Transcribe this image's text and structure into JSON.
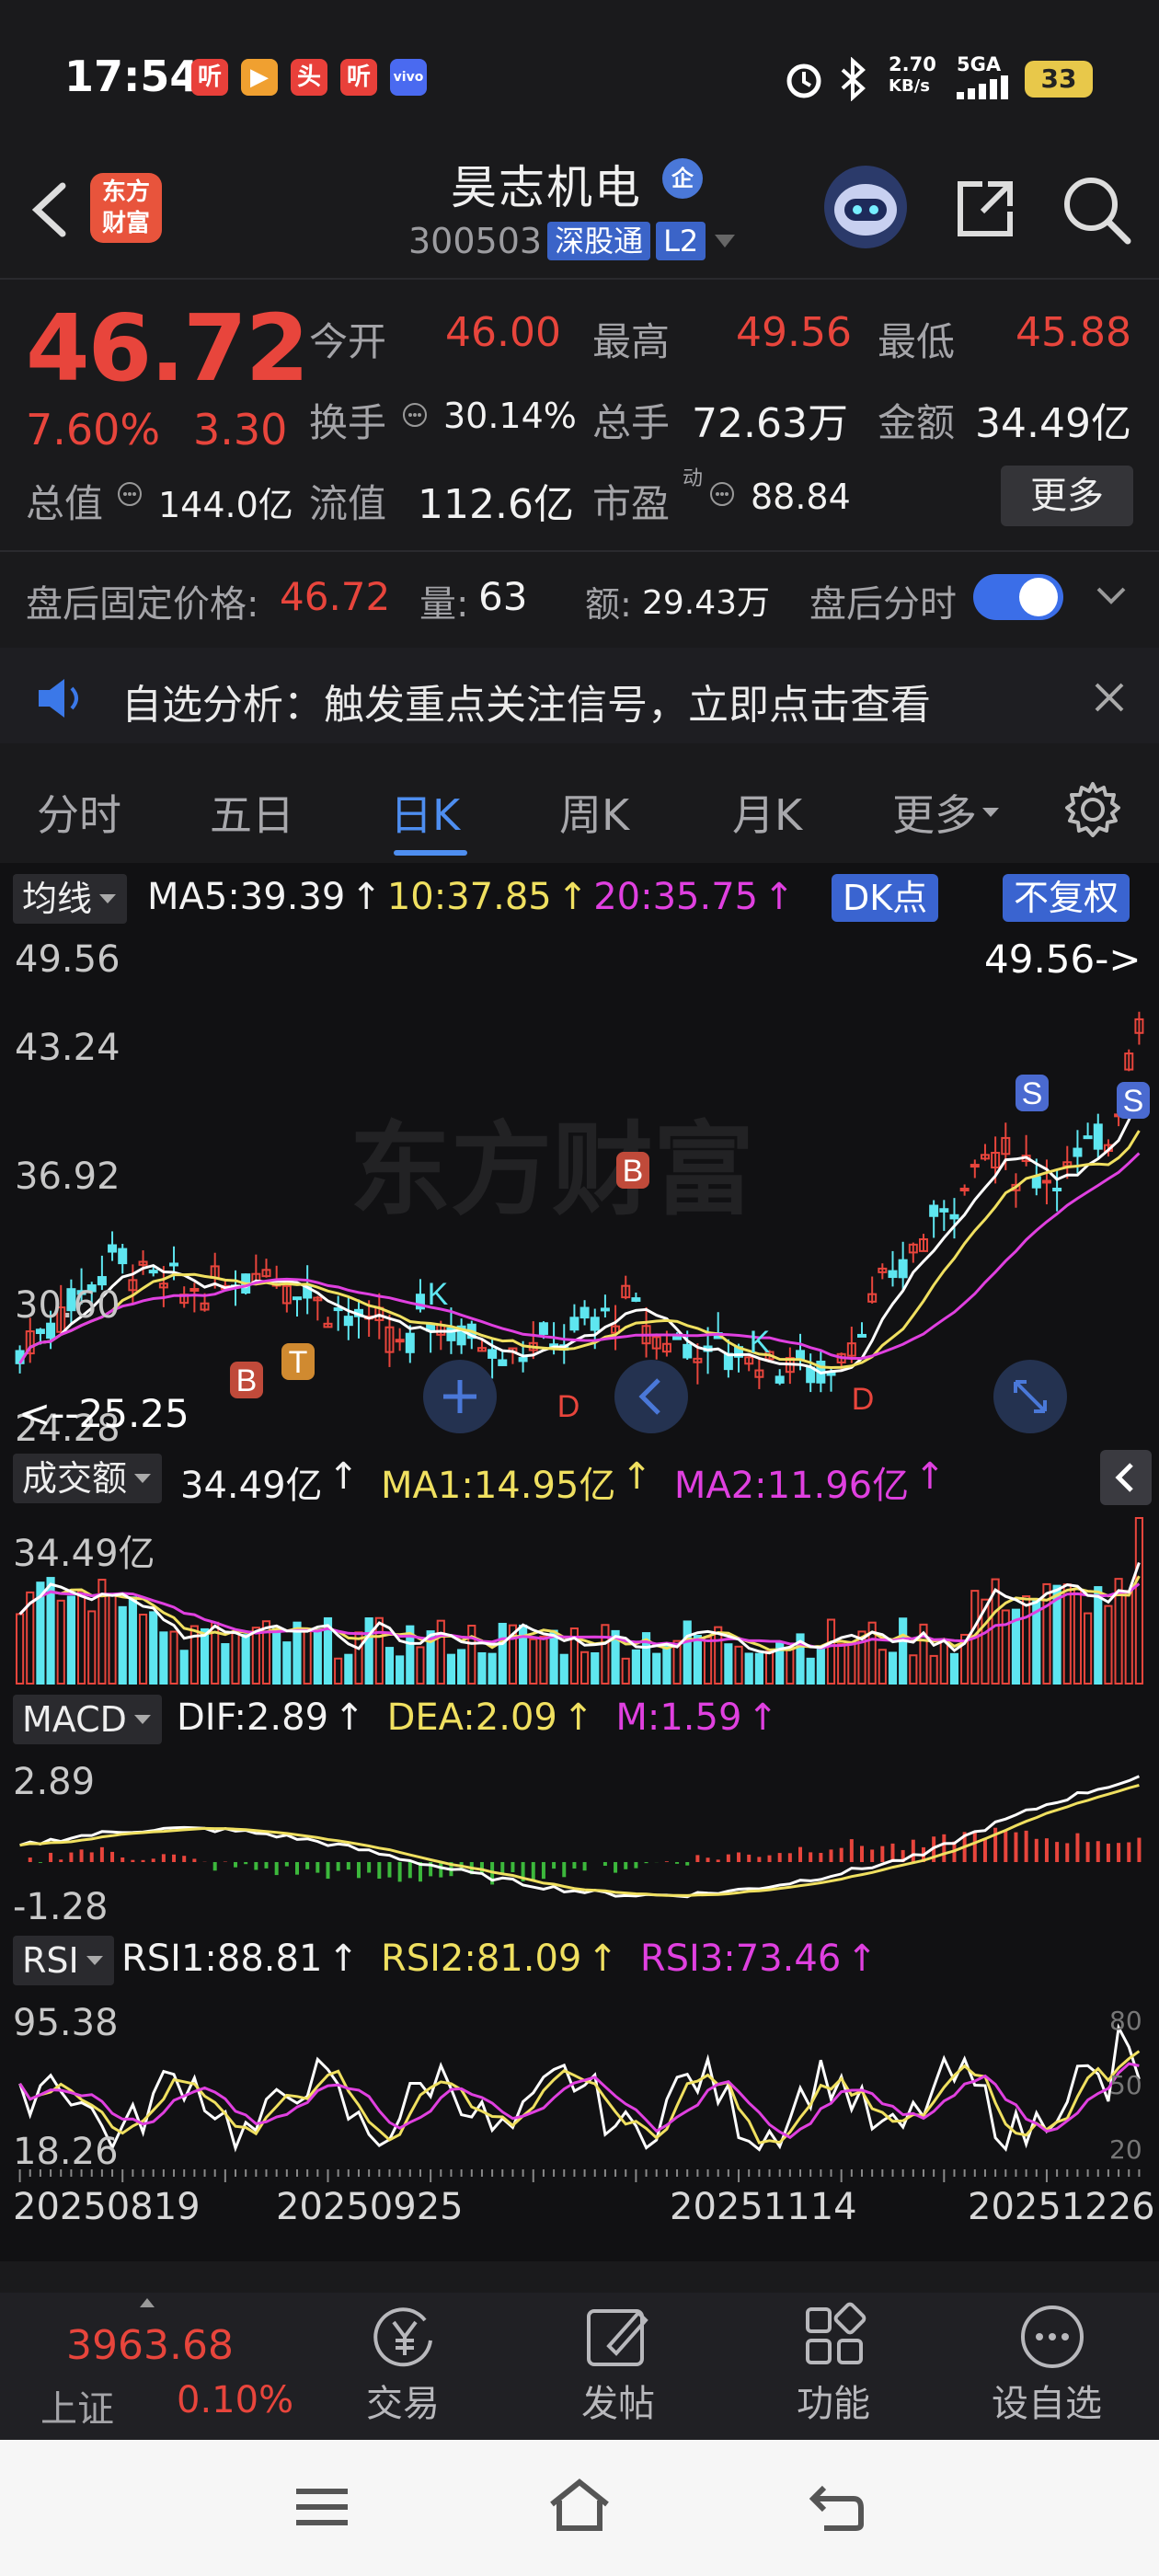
{
  "status_bar": {
    "time": "17:54",
    "net_speed_value": "2.70",
    "net_speed_unit": "KB/s",
    "network": "5GA",
    "battery": "33",
    "apps": [
      "听",
      "▶",
      "头",
      "听",
      "vivo"
    ]
  },
  "header": {
    "logo_line1": "东方",
    "logo_line2": "财富",
    "stock_name": "昊志机电",
    "qi_badge": "企",
    "stock_code": "300503",
    "tag_connect": "深股通",
    "tag_level": "L2"
  },
  "quote": {
    "price": "46.72",
    "pct_change": "7.60%",
    "change": "3.30",
    "open_label": "今开",
    "open_value": "46.00",
    "high_label": "最高",
    "high_value": "49.56",
    "low_label": "最低",
    "low_value": "45.88",
    "turnover_label": "换手",
    "turnover_value": "30.14%",
    "volume_label": "总手",
    "volume_value": "72.63万",
    "amount_label": "金额",
    "amount_value": "34.49亿",
    "mktcap_label": "总值",
    "mktcap_value": "144.0亿",
    "float_label": "流值",
    "float_value": "112.6亿",
    "pe_label": "市盈",
    "pe_sup": "动",
    "pe_value": "88.84",
    "more_button": "更多"
  },
  "after_hours": {
    "price_label": "盘后固定价格:",
    "price_value": "46.72",
    "vol_label": "量:",
    "vol_value": "63",
    "amt_label": "额:",
    "amt_value": "29.43万",
    "toggle_label": "盘后分时",
    "toggle_on": true
  },
  "notice": {
    "text": "自选分析：触发重点关注信号，立即点击查看"
  },
  "tabs": [
    {
      "label": "分时",
      "active": false
    },
    {
      "label": "五日",
      "active": false
    },
    {
      "label": "日K",
      "active": true
    },
    {
      "label": "周K",
      "active": false
    },
    {
      "label": "月K",
      "active": false
    },
    {
      "label": "更多",
      "active": false
    }
  ],
  "ma_legend": {
    "selector": "均线",
    "ma5": "MA5:39.39",
    "ma10": "10:37.85",
    "ma20": "20:35.75",
    "arrow": "↑",
    "dk_button": "DK点",
    "fq_button": "不复权"
  },
  "kline_axis": {
    "high": "49.56",
    "tick2": "43.24",
    "tick3": "36.92",
    "tick4": "30.60",
    "low": "24.28",
    "high_marker": "49.56->",
    "low_marker": "<--25.25",
    "watermark": "东方财富",
    "markers": [
      "B",
      "T",
      "B",
      "K",
      "K",
      "S",
      "S",
      "D",
      "D"
    ]
  },
  "vol_legend": {
    "selector": "成交额",
    "value": "34.49亿",
    "ma1": "MA1:14.95亿",
    "ma2": "MA2:11.96亿",
    "arrow": "↑",
    "axis_top": "34.49亿"
  },
  "macd_legend": {
    "selector": "MACD",
    "dif": "DIF:2.89",
    "dea": "DEA:2.09",
    "m": "M:1.59",
    "arrow": "↑",
    "axis_top": "2.89",
    "axis_bottom": "-1.28"
  },
  "rsi_legend": {
    "selector": "RSI",
    "rsi1": "RSI1:88.81",
    "rsi2": "RSI2:81.09",
    "rsi3": "RSI3:73.46",
    "arrow": "↑",
    "axis_top": "95.38",
    "axis_bottom": "18.26",
    "ref_high": "80",
    "ref_mid": "50",
    "ref_low": "20"
  },
  "dates": [
    "20250819",
    "20250925",
    "20251114",
    "20251226"
  ],
  "bottom_bar": {
    "index_value": "3963.68",
    "index_name": "上证",
    "index_pct": "0.10%",
    "trade": "交易",
    "post": "发帖",
    "function": "功能",
    "add_watch": "设自选"
  },
  "colors": {
    "up": "#e8453c",
    "down": "#5ee6f0",
    "ma5": "#ffffff",
    "ma10": "#f0e060",
    "ma20": "#e040e0",
    "accent": "#3b6ee8"
  }
}
